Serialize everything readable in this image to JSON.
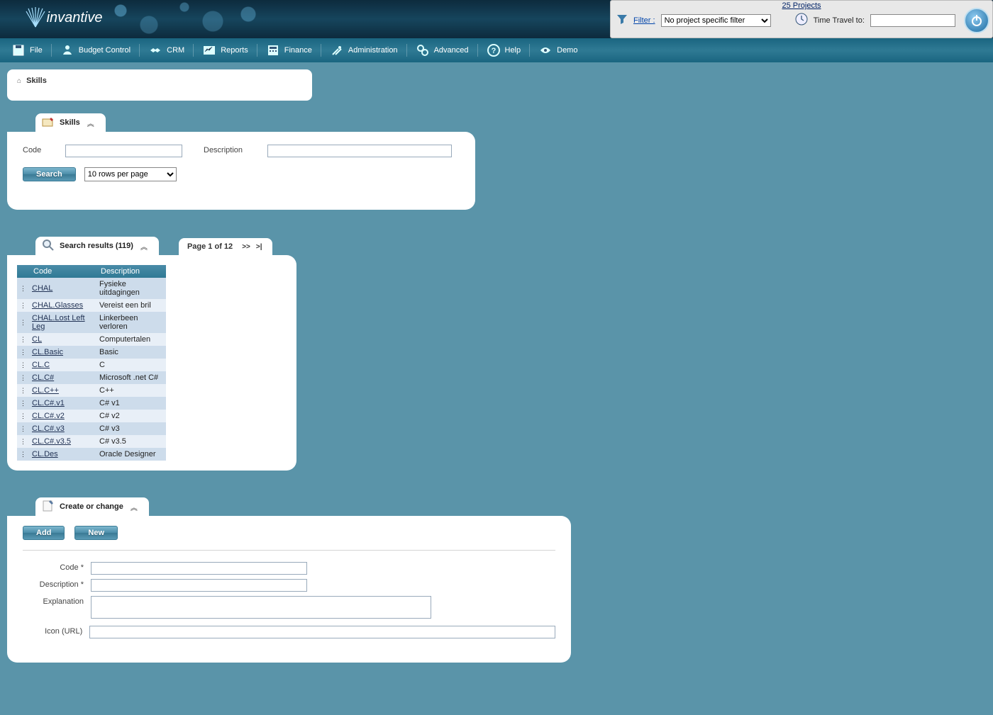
{
  "brand": "invantive",
  "header": {
    "projects_link": "25 Projects",
    "filter_label": "Filter :",
    "filter_selected": "No project specific filter",
    "time_travel_label": "Time Travel to:",
    "time_travel_value": ""
  },
  "menu": {
    "file": "File",
    "budget": "Budget Control",
    "crm": "CRM",
    "reports": "Reports",
    "finance": "Finance",
    "admin": "Administration",
    "advanced": "Advanced",
    "help": "Help",
    "demo": "Demo"
  },
  "breadcrumb": {
    "current": "Skills"
  },
  "search_panel": {
    "title": "Skills",
    "code_label": "Code",
    "code_value": "",
    "desc_label": "Description",
    "desc_value": "",
    "search_btn": "Search",
    "rows_selected": "10 rows per page"
  },
  "results": {
    "title": "Search results (119)",
    "pager": {
      "label": "Page 1 of 12",
      "next": ">>",
      "last": ">|"
    },
    "col_code": "Code",
    "col_desc": "Description",
    "rows": [
      {
        "code": "CHAL",
        "desc": "Fysieke uitdagingen"
      },
      {
        "code": "CHAL.Glasses",
        "desc": "Vereist een bril"
      },
      {
        "code": "CHAL.Lost Left Leg",
        "desc": "Linkerbeen verloren"
      },
      {
        "code": "CL",
        "desc": "Computertalen"
      },
      {
        "code": "CL.Basic",
        "desc": "Basic"
      },
      {
        "code": "CL.C",
        "desc": "C"
      },
      {
        "code": "CL.C#",
        "desc": "Microsoft .net C#"
      },
      {
        "code": "CL.C++",
        "desc": "C++"
      },
      {
        "code": "CL.C#.v1",
        "desc": "C# v1"
      },
      {
        "code": "CL.C#.v2",
        "desc": "C# v2"
      },
      {
        "code": "CL.C#.v3",
        "desc": "C# v3"
      },
      {
        "code": "CL.C#.v3.5",
        "desc": "C# v3.5"
      },
      {
        "code": "CL.Des",
        "desc": "Oracle Designer"
      }
    ]
  },
  "create_change": {
    "title": "Create or change",
    "add_btn": "Add",
    "new_btn": "New",
    "code_label": "Code *",
    "code_value": "",
    "desc_label": "Description *",
    "desc_value": "",
    "expl_label": "Explanation",
    "expl_value": "",
    "icon_label": "Icon (URL)",
    "icon_value": ""
  }
}
